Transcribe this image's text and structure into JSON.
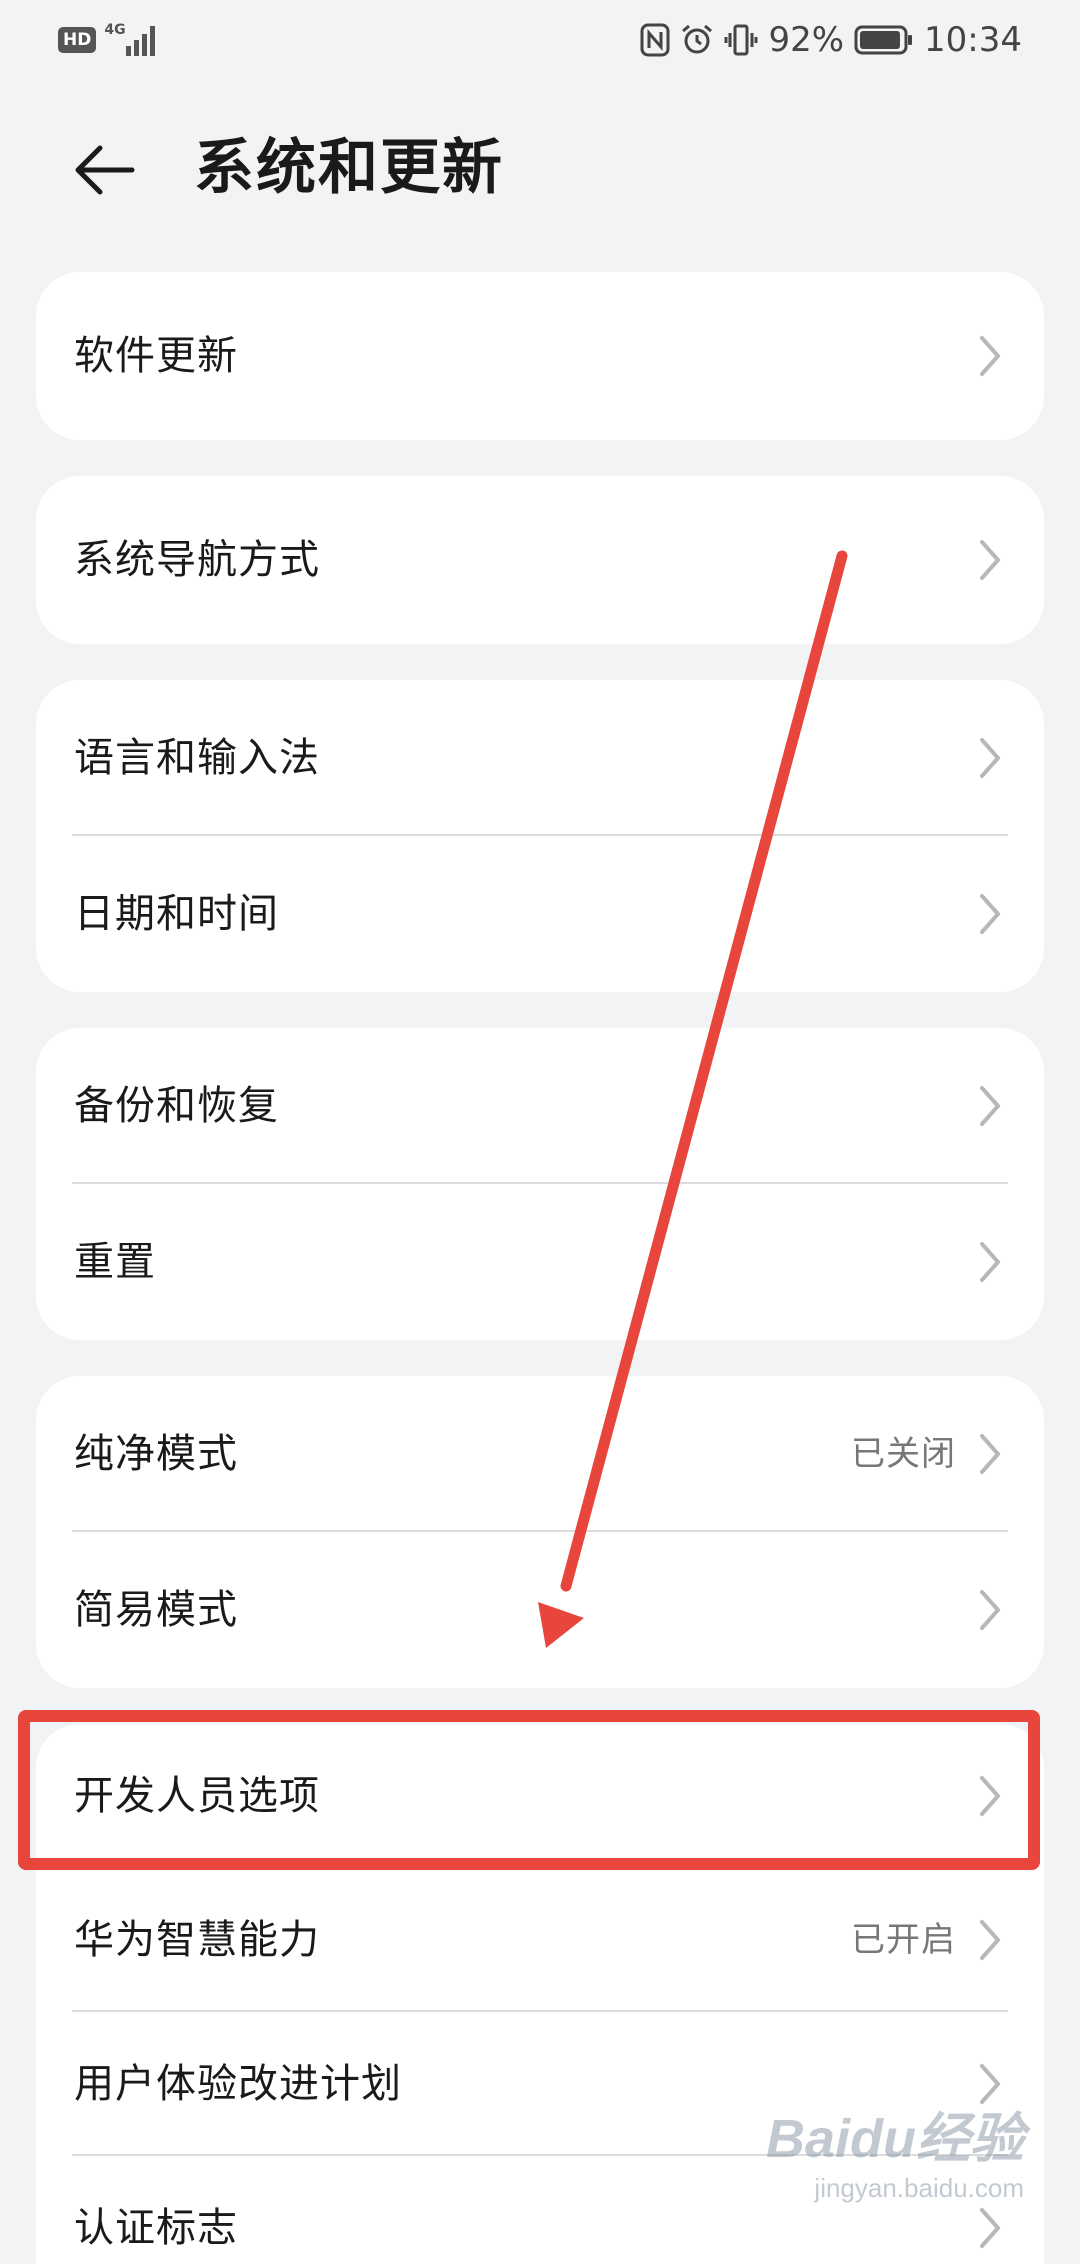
{
  "status_bar": {
    "hd_badge": "HD",
    "network_type": "4G",
    "battery_percent": "92%",
    "time": "10:34",
    "icons": [
      "nfc-icon",
      "alarm-icon",
      "vibrate-icon",
      "battery-icon"
    ]
  },
  "header": {
    "title": "系统和更新",
    "back_icon": "back-arrow-icon"
  },
  "groups": [
    {
      "items": [
        {
          "label": "软件更新",
          "value": ""
        }
      ]
    },
    {
      "items": [
        {
          "label": "系统导航方式",
          "value": ""
        }
      ]
    },
    {
      "items": [
        {
          "label": "语言和输入法",
          "value": ""
        },
        {
          "label": "日期和时间",
          "value": ""
        }
      ]
    },
    {
      "items": [
        {
          "label": "备份和恢复",
          "value": ""
        },
        {
          "label": "重置",
          "value": ""
        }
      ]
    },
    {
      "items": [
        {
          "label": "纯净模式",
          "value": "已关闭"
        },
        {
          "label": "简易模式",
          "value": ""
        }
      ]
    },
    {
      "items": [
        {
          "label": "开发人员选项",
          "value": ""
        },
        {
          "label": "华为智慧能力",
          "value": "已开启"
        },
        {
          "label": "用户体验改进计划",
          "value": ""
        },
        {
          "label": "认证标志",
          "value": ""
        }
      ]
    }
  ],
  "annotation": {
    "highlight_color": "#e8463c",
    "highlighted_item": "开发人员选项"
  },
  "watermark": {
    "logo": "Baidu经验",
    "url": "jingyan.baidu.com"
  }
}
